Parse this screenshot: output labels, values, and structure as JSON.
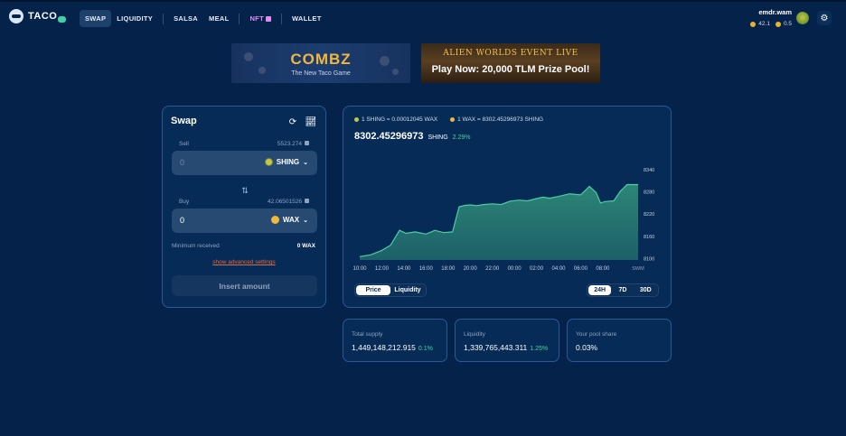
{
  "nav": {
    "logo": "TACO",
    "links": [
      {
        "label": "SWAP",
        "active": true
      },
      {
        "label": "LIQUIDITY"
      },
      {
        "label": "SALSA"
      },
      {
        "label": "MEAL"
      },
      {
        "label": "NFT"
      },
      {
        "label": "WALLET"
      }
    ],
    "username": "emdr.wam",
    "balance_1": "42.1",
    "balance_2": "0.5"
  },
  "banners": {
    "combz_title": "COMBZ",
    "combz_sub": "The New Taco Game",
    "alien_sub": "ALIEN WORLDS EVENT LIVE",
    "alien_title": "Play Now: 20,000 TLM Prize Pool!"
  },
  "swap": {
    "title": "Swap",
    "sell_label": "Sell",
    "sell_balance": "5523.274",
    "sell_value": "0",
    "sell_token": "SHING",
    "buy_label": "Buy",
    "buy_balance": "42.06501526",
    "buy_value": "0",
    "buy_token": "WAX",
    "min_label": "Minimum received",
    "min_value": "0 WAX",
    "advanced": "show advanced settings",
    "submit": "Insert amount"
  },
  "chart_panel": {
    "rate_1": "1 SHING = 0.00012045 WAX",
    "rate_2": "1 WAX = 8302.45296973 SHING",
    "price": "8302.45296973",
    "price_token": "SHING",
    "price_change": "2.29%",
    "tabs": [
      "Price",
      "Liquidity"
    ],
    "periods": [
      "24H",
      "7D",
      "30D"
    ]
  },
  "chart_data": {
    "type": "area",
    "title": "",
    "xlabel": "",
    "ylabel": "",
    "x_ticks": [
      "10:00",
      "12:00",
      "14:00",
      "16:00",
      "18:00",
      "20:00",
      "22:00",
      "00:00",
      "02:00",
      "04:00",
      "06:00",
      "08:00"
    ],
    "y_ticks": [
      8100,
      8160,
      8220,
      8280,
      8340
    ],
    "y_axis_note": "SWM",
    "ylim": [
      8096,
      8350
    ],
    "x": [
      0,
      0.5,
      1.0,
      1.4,
      1.8,
      2.1,
      2.5,
      3.0,
      3.4,
      3.8,
      4.2,
      4.5,
      4.8,
      5.0,
      5.3,
      5.6,
      6.0,
      6.4,
      6.8,
      7.2,
      7.6,
      8.0,
      8.3,
      8.6,
      9.0,
      9.5,
      10.0,
      10.4,
      10.7,
      10.9,
      11.1,
      11.5,
      11.8,
      12.1,
      12.3,
      12.6
    ],
    "y": [
      8105,
      8110,
      8122,
      8136,
      8176,
      8168,
      8172,
      8166,
      8176,
      8170,
      8172,
      8240,
      8244,
      8245,
      8243,
      8246,
      8248,
      8246,
      8255,
      8258,
      8256,
      8262,
      8266,
      8263,
      8268,
      8275,
      8272,
      8295,
      8278,
      8250,
      8254,
      8256,
      8282,
      8300,
      8300,
      8300
    ],
    "grid": false,
    "legend": "none",
    "fill_color": "#2f8a78",
    "line_color": "#48d1a4"
  },
  "stats": [
    {
      "label": "Total supply",
      "value": "1,449,148,212.915",
      "change": "0.1%"
    },
    {
      "label": "Liquidity",
      "value": "1,339,765,443.311",
      "change": "1.25%"
    },
    {
      "label": "Your pool share",
      "value": "0.03%",
      "change": ""
    }
  ]
}
